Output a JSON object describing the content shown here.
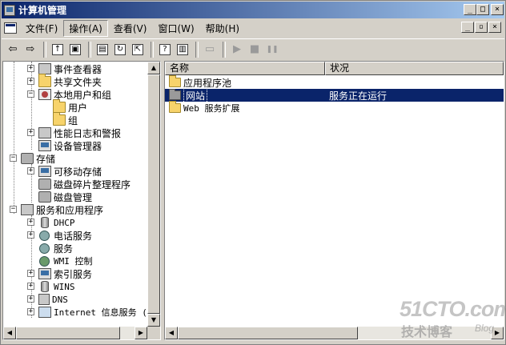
{
  "window": {
    "title": "计算机管理"
  },
  "menu": {
    "items": [
      "文件(F)",
      "操作(A)",
      "查看(V)",
      "窗口(W)",
      "帮助(H)"
    ]
  },
  "caption_buttons": {
    "minimize": "_",
    "maximize": "□",
    "close": "×"
  },
  "mdi_buttons": {
    "minimize": "_",
    "restore": "▫",
    "close": "×"
  },
  "toolbar": {
    "buttons": [
      {
        "icon": "back-arrow-icon",
        "glyph": "⇦",
        "enabled": true
      },
      {
        "icon": "forward-arrow-icon",
        "glyph": "⇨",
        "enabled": true
      },
      {
        "icon": "up-folder-icon",
        "glyph": "↑",
        "enabled": true
      },
      {
        "icon": "show-hide-tree-icon",
        "glyph": "▣",
        "enabled": true
      },
      {
        "icon": "properties-icon",
        "glyph": "▤",
        "enabled": true
      },
      {
        "icon": "refresh-icon",
        "glyph": "↻",
        "enabled": true
      },
      {
        "icon": "export-list-icon",
        "glyph": "⇱",
        "enabled": true
      },
      {
        "icon": "help-icon",
        "glyph": "?",
        "enabled": true
      },
      {
        "icon": "show-action-pane-icon",
        "glyph": "▥",
        "enabled": true
      },
      {
        "icon": "connect-computer-icon",
        "glyph": "▭",
        "enabled": false
      },
      {
        "icon": "play-icon",
        "glyph": "▶",
        "enabled": false
      },
      {
        "icon": "stop-icon",
        "glyph": "■",
        "enabled": false
      },
      {
        "icon": "pause-icon",
        "glyph": "❚❚",
        "enabled": false
      }
    ]
  },
  "tree": {
    "items": [
      {
        "label": "事件查看器",
        "icon": "event-viewer-icon"
      },
      {
        "label": "共享文件夹",
        "icon": "shared-folders-icon"
      },
      {
        "label": "本地用户和组",
        "icon": "users-icon"
      },
      {
        "label": "用户",
        "icon": "folder-icon"
      },
      {
        "label": "组",
        "icon": "folder-icon"
      },
      {
        "label": "性能日志和警报",
        "icon": "performance-icon"
      },
      {
        "label": "设备管理器",
        "icon": "device-manager-icon"
      },
      {
        "label": "存储",
        "icon": "storage-icon"
      },
      {
        "label": "可移动存储",
        "icon": "removable-storage-icon"
      },
      {
        "label": "磁盘碎片整理程序",
        "icon": "defrag-icon"
      },
      {
        "label": "磁盘管理",
        "icon": "disk-management-icon"
      },
      {
        "label": "服务和应用程序",
        "icon": "services-apps-icon"
      },
      {
        "label": "DHCP",
        "icon": "dhcp-icon"
      },
      {
        "label": "电话服务",
        "icon": "telephony-icon"
      },
      {
        "label": "服务",
        "icon": "services-icon"
      },
      {
        "label": "WMI 控制",
        "icon": "wmi-icon"
      },
      {
        "label": "索引服务",
        "icon": "indexing-icon"
      },
      {
        "label": "WINS",
        "icon": "wins-icon"
      },
      {
        "label": "DNS",
        "icon": "dns-icon"
      },
      {
        "label": "Internet 信息服务 (II",
        "icon": "iis-icon"
      }
    ]
  },
  "list": {
    "columns": [
      "名称",
      "状况"
    ],
    "rows": [
      {
        "name": "应用程序池",
        "status": "",
        "icon": "folder-icon"
      },
      {
        "name": "网站",
        "status": "服务正在运行",
        "icon": "folder-icon"
      },
      {
        "name": "Web 服务扩展",
        "status": "",
        "icon": "folder-icon"
      }
    ]
  },
  "watermark": {
    "brand": "51CTO.com",
    "tagline": "技术博客",
    "blog": "Blog"
  },
  "colors": {
    "title_start": "#0a246a",
    "title_end": "#a6caf0",
    "selection": "#0a246a",
    "face": "#d4d0c8"
  }
}
